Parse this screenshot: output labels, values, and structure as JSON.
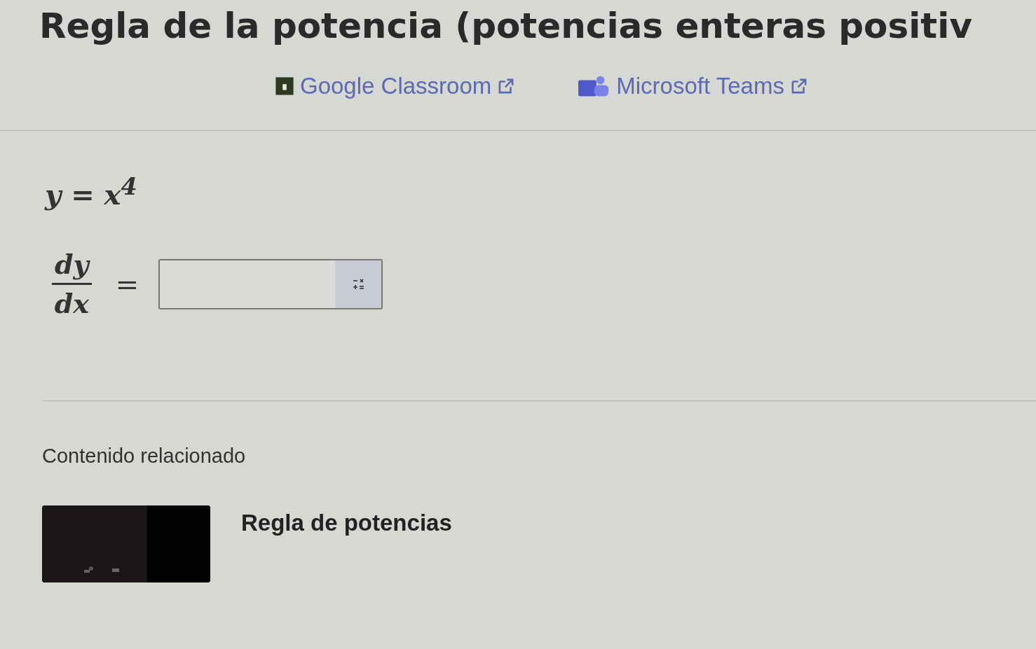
{
  "title": "Regla de la potencia (potencias enteras positiv",
  "share_links": [
    {
      "label": "Google Classroom",
      "kind": "classroom"
    },
    {
      "label": "Microsoft Teams",
      "kind": "teams"
    }
  ],
  "question": {
    "equation": "y = x$^{4}$",
    "numerator": "dy",
    "denominator": "dx",
    "equals": "="
  },
  "related": {
    "heading": "Contenido relacionado",
    "items": [
      {
        "title": "Regla de potencias",
        "kind": "picture"
      }
    ]
  }
}
